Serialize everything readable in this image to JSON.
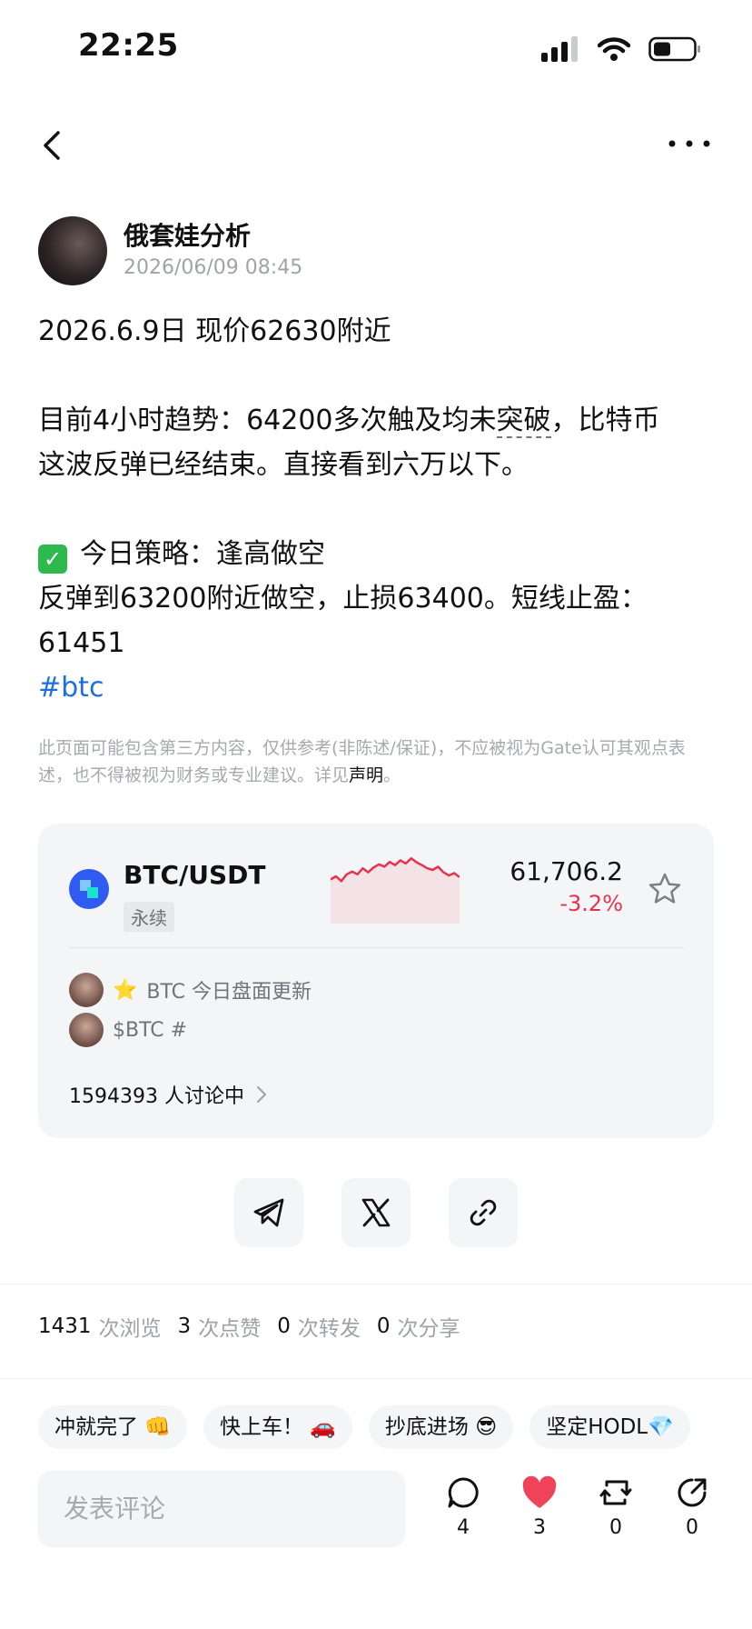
{
  "status_bar": {
    "time": "22:25"
  },
  "post": {
    "author": "俄套娃分析",
    "timestamp": "2026/06/09 08:45",
    "line1": "2026.6.9日 现价62630附近",
    "line2a": "目前4小时趋势：64200多次触及均未",
    "line2b": "突破",
    "line2c": "，比特币",
    "line3": "这波反弹已经结束。直接看到六万以下。",
    "strategy_label": "今日策略：逢高做空",
    "strategy_detail": "反弹到63200附近做空，止损63400。短线止盈：",
    "target": "61451",
    "hashtag": "#btc"
  },
  "disclaimer": {
    "text": "此页面可能包含第三方内容，仅供参考(非陈述/保证)，不应被视为Gate认可其观点表述，也不得被视为财务或专业建议。详见",
    "link": "声明",
    "end": "。"
  },
  "market_card": {
    "pair": "BTC/USDT",
    "tag": "永续",
    "price": "61,706.2",
    "change": "-3.2%",
    "sparkline": [
      0.42,
      0.5,
      0.38,
      0.55,
      0.62,
      0.55,
      0.7,
      0.6,
      0.72,
      0.8,
      0.74,
      0.86,
      0.78,
      0.9,
      0.82,
      0.95,
      0.85,
      0.78,
      0.7,
      0.66,
      0.74,
      0.6,
      0.52,
      0.58,
      0.48
    ],
    "topics": [
      {
        "sticker": "⭐",
        "text": "BTC 今日盘面更新"
      },
      {
        "sticker": "",
        "text": "$BTC #"
      }
    ],
    "discussion": "1594393 人讨论中"
  },
  "stats": [
    {
      "num": "1431",
      "unit": "次浏览"
    },
    {
      "num": "3",
      "unit": "次点赞"
    },
    {
      "num": "0",
      "unit": "次转发"
    },
    {
      "num": "0",
      "unit": "次分享"
    }
  ],
  "quick_replies": [
    "冲就完了 👊",
    "快上车！ 🚗",
    "抄底进场 😎",
    "坚定HODL💎"
  ],
  "comment": {
    "placeholder": "发表评论"
  },
  "actions": {
    "comments": "4",
    "likes": "3",
    "reposts": "0",
    "shares": "0"
  },
  "colors": {
    "accent_red": "#e5334f",
    "link_blue": "#1d6fe0",
    "like_red": "#f0435a"
  }
}
